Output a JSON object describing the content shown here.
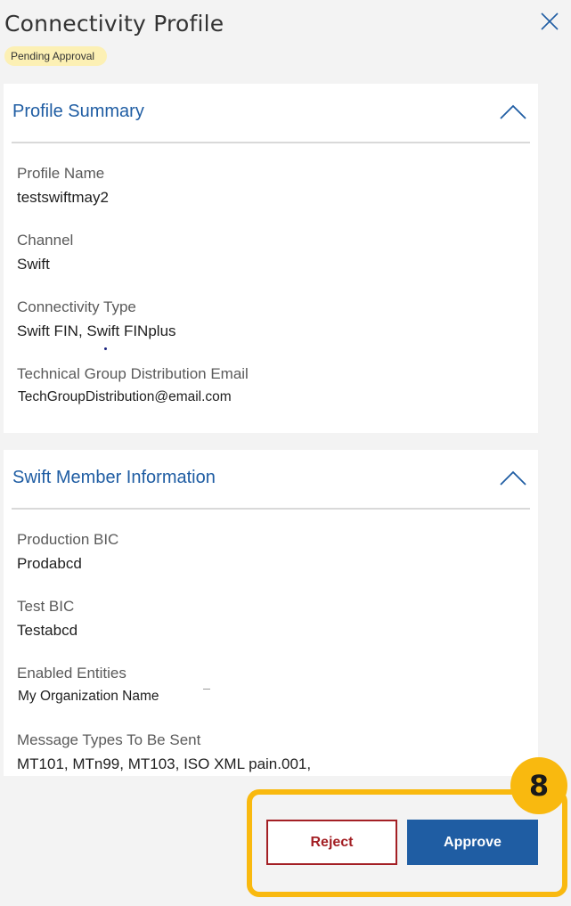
{
  "header": {
    "title": "Connectivity Profile",
    "status": "Pending Approval",
    "close_icon": "close-icon"
  },
  "colors": {
    "accent": "#1f5da3",
    "reject": "#a31f24",
    "badge": "#fcf0b4",
    "highlight": "#f9b90f"
  },
  "profile_summary": {
    "title": "Profile Summary",
    "toggle_icon": "chevron-up-icon",
    "fields": [
      {
        "label": "Profile Name",
        "value": "testswiftmay2"
      },
      {
        "label": "Channel",
        "value": "Swift"
      },
      {
        "label": "Connectivity Type",
        "value": "Swift FIN, Swift FINplus"
      },
      {
        "label": "Technical Group Distribution Email",
        "value": "TechGroupDistribution@email.com"
      }
    ]
  },
  "swift_member": {
    "title": "Swift Member Information",
    "toggle_icon": "chevron-up-icon",
    "fields": [
      {
        "label": "Production BIC",
        "value": "Prodabcd"
      },
      {
        "label": "Test BIC",
        "value": "Testabcd"
      },
      {
        "label": "Enabled Entities",
        "value": "My Organization Name"
      },
      {
        "label": "Message Types To Be Sent",
        "value": "MT101, MTn99, MT103, ISO XML pain.001,"
      }
    ]
  },
  "actions": {
    "reject_label": "Reject",
    "approve_label": "Approve"
  },
  "step": {
    "number": "8"
  }
}
